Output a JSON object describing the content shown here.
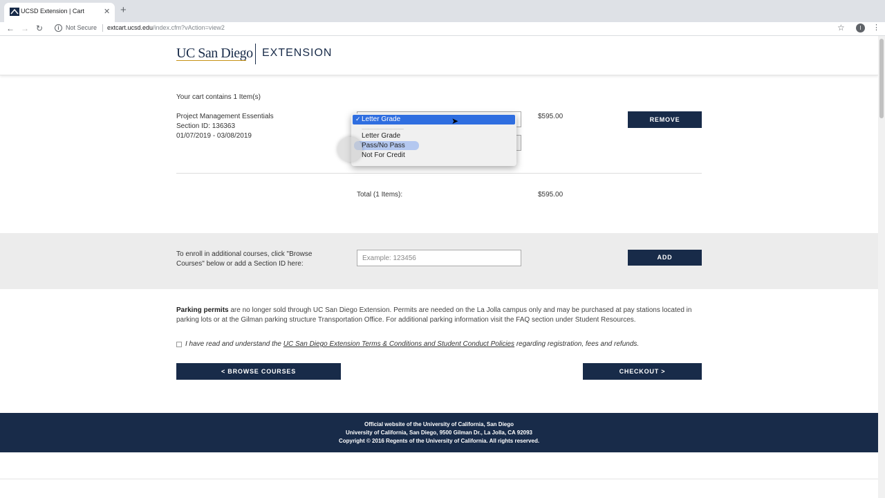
{
  "browser": {
    "tab_title": "UCSD Extension | Cart",
    "tab_close": "✕",
    "new_tab": "+",
    "security": "Not Secure",
    "url_host": "extcart.ucsd.edu",
    "url_path": "/index.cfm?vAction=view2",
    "profile_initial": "I",
    "icons": {
      "back": "arrow-left-icon",
      "forward": "arrow-right-icon",
      "reload": "reload-icon",
      "info": "info-icon",
      "bookmark": "star-icon",
      "menu": "kebab-menu-icon"
    }
  },
  "header": {
    "logo_ucsd": "UC San Diego",
    "logo_extension": "EXTENSION"
  },
  "cart": {
    "count_text": "Your cart contains 1 Item(s)",
    "item": {
      "title": "Project Management Essentials",
      "section": "Section ID: 136363",
      "dates": "01/07/2019 - 03/08/2019",
      "price": "$595.00",
      "remove_label": "REMOVE"
    },
    "grade_dropdown": {
      "selected": "Letter Grade",
      "separator": "----------------------------",
      "options": [
        "Letter Grade",
        "Pass/No Pass",
        "Not For Credit"
      ],
      "hovered": "Pass/No Pass"
    },
    "total_label": "Total (1 Items):",
    "total_price": "$595.00"
  },
  "enroll": {
    "text": "To enroll in additional courses, click \"Browse Courses\" below or add a Section ID here:",
    "placeholder": "Example: 123456",
    "add_label": "ADD"
  },
  "parking": {
    "bold": "Parking permits",
    "text": " are no longer sold through UC San Diego Extension. Permits are needed on the La Jolla campus only and may be purchased at pay stations located in parking lots or at the Gilman parking structure Transportation Office. For additional parking information visit the FAQ section under Student Resources."
  },
  "terms": {
    "prefix": "I have read and understand the ",
    "link": "UC San Diego Extension Terms & Conditions and Student Conduct Policies",
    "suffix": " regarding registration, fees and refunds."
  },
  "actions": {
    "browse_label": "< BROWSE COURSES",
    "checkout_label": "CHECKOUT >"
  },
  "footer": {
    "line1": "Official website of the University of California, San Diego",
    "line2": "University of California, San Diego, 9500 Gilman Dr., La Jolla, CA 92093",
    "line3": "Copyright © 2016 Regents of the University of California. All rights reserved."
  },
  "colors": {
    "navy": "#182b49",
    "gold": "#c69214",
    "select_highlight": "#2f6ee0"
  }
}
